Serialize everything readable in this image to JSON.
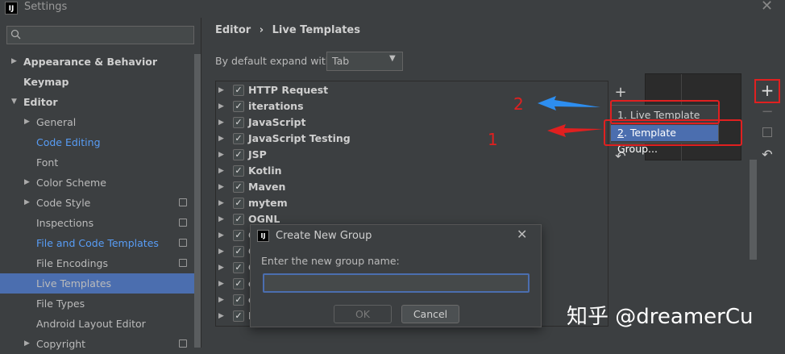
{
  "window": {
    "title": "Settings",
    "app_icon": "IJ"
  },
  "sidebar": {
    "search_placeholder": "",
    "items": [
      {
        "label": "Appearance & Behavior",
        "arrow": "▶",
        "level": 0,
        "style": "bold"
      },
      {
        "label": "Keymap",
        "arrow": "",
        "level": 0,
        "style": "bold"
      },
      {
        "label": "Editor",
        "arrow": "▼",
        "level": 0,
        "style": "bold"
      },
      {
        "label": "General",
        "arrow": "▶",
        "level": 1,
        "style": ""
      },
      {
        "label": "Code Editing",
        "arrow": "",
        "level": 1,
        "style": "blue"
      },
      {
        "label": "Font",
        "arrow": "",
        "level": 1,
        "style": ""
      },
      {
        "label": "Color Scheme",
        "arrow": "▶",
        "level": 1,
        "style": ""
      },
      {
        "label": "Code Style",
        "arrow": "▶",
        "level": 1,
        "style": "",
        "badge": true
      },
      {
        "label": "Inspections",
        "arrow": "",
        "level": 1,
        "style": "",
        "badge": true
      },
      {
        "label": "File and Code Templates",
        "arrow": "",
        "level": 1,
        "style": "blue",
        "badge": true
      },
      {
        "label": "File Encodings",
        "arrow": "",
        "level": 1,
        "style": "",
        "badge": true
      },
      {
        "label": "Live Templates",
        "arrow": "",
        "level": 1,
        "style": "",
        "selected": true
      },
      {
        "label": "File Types",
        "arrow": "",
        "level": 1,
        "style": ""
      },
      {
        "label": "Android Layout Editor",
        "arrow": "",
        "level": 1,
        "style": ""
      },
      {
        "label": "Copyright",
        "arrow": "▶",
        "level": 1,
        "style": "",
        "badge": true
      }
    ]
  },
  "main": {
    "breadcrumb": {
      "parent": "Editor",
      "separator": "›",
      "current": "Live Templates"
    },
    "expand_label": "By default expand with",
    "expand_value": "Tab",
    "templates": [
      {
        "label": "HTTP Request"
      },
      {
        "label": "iterations"
      },
      {
        "label": "JavaScript"
      },
      {
        "label": "JavaScript Testing"
      },
      {
        "label": "JSP"
      },
      {
        "label": "Kotlin"
      },
      {
        "label": "Maven"
      },
      {
        "label": "mytem"
      },
      {
        "label": "OGNL"
      },
      {
        "label": "O"
      },
      {
        "label": "O"
      },
      {
        "label": "O"
      },
      {
        "label": "o"
      },
      {
        "label": "o"
      },
      {
        "label": "F"
      }
    ]
  },
  "popup_menu": {
    "items": [
      {
        "num": "1",
        "text": ". Live Template"
      },
      {
        "num": "2",
        "text": ". Template Group..."
      }
    ]
  },
  "annotations": {
    "num_top": "2",
    "num_bottom": "1",
    "arrow_top_color": "#2d8ef0",
    "arrow_bottom_color": "#e02020"
  },
  "dialog": {
    "title": "Create New Group",
    "prompt": "Enter the new group name:",
    "input_value": "",
    "ok": "OK",
    "cancel": "Cancel"
  },
  "watermark": "知乎 @dreamerCu",
  "colors": {
    "selection": "#4b6eaf",
    "link": "#589df6",
    "annotation_red": "#e02020"
  }
}
